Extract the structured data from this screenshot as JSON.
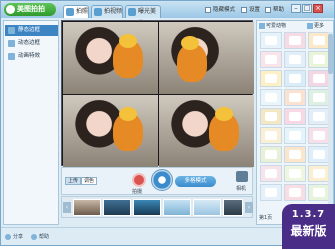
{
  "app": {
    "logo_text": "美图拍拍"
  },
  "titlebar": {
    "tabs": [
      {
        "label": "拍照"
      },
      {
        "label": "拍视频"
      },
      {
        "label": "曝光美发"
      }
    ],
    "options": [
      {
        "label": "隐藏模式"
      },
      {
        "label": "设置"
      },
      {
        "label": "帮助"
      }
    ]
  },
  "sidebar": {
    "items": [
      {
        "label": "静态边框"
      },
      {
        "label": "动态边框"
      },
      {
        "label": "动画特效"
      }
    ]
  },
  "controls": {
    "toggle_left": "上传",
    "toggle_right": "调色",
    "shoot_small_label": "拍摄",
    "mode_button": "多格模式",
    "right_label": "相机"
  },
  "right_panel": {
    "tabs": [
      {
        "label": "可爱动物"
      },
      {
        "label": "更多"
      }
    ],
    "bottom_text": "第1页"
  },
  "status": {
    "left": "分享",
    "middle": "帮助"
  },
  "version_badge": {
    "version": "1.3.7",
    "label": "最新版"
  },
  "colors": {
    "accent": "#3d84c3",
    "badge_bg": "#4a2d86",
    "logo_green": "#2f9a2b"
  }
}
